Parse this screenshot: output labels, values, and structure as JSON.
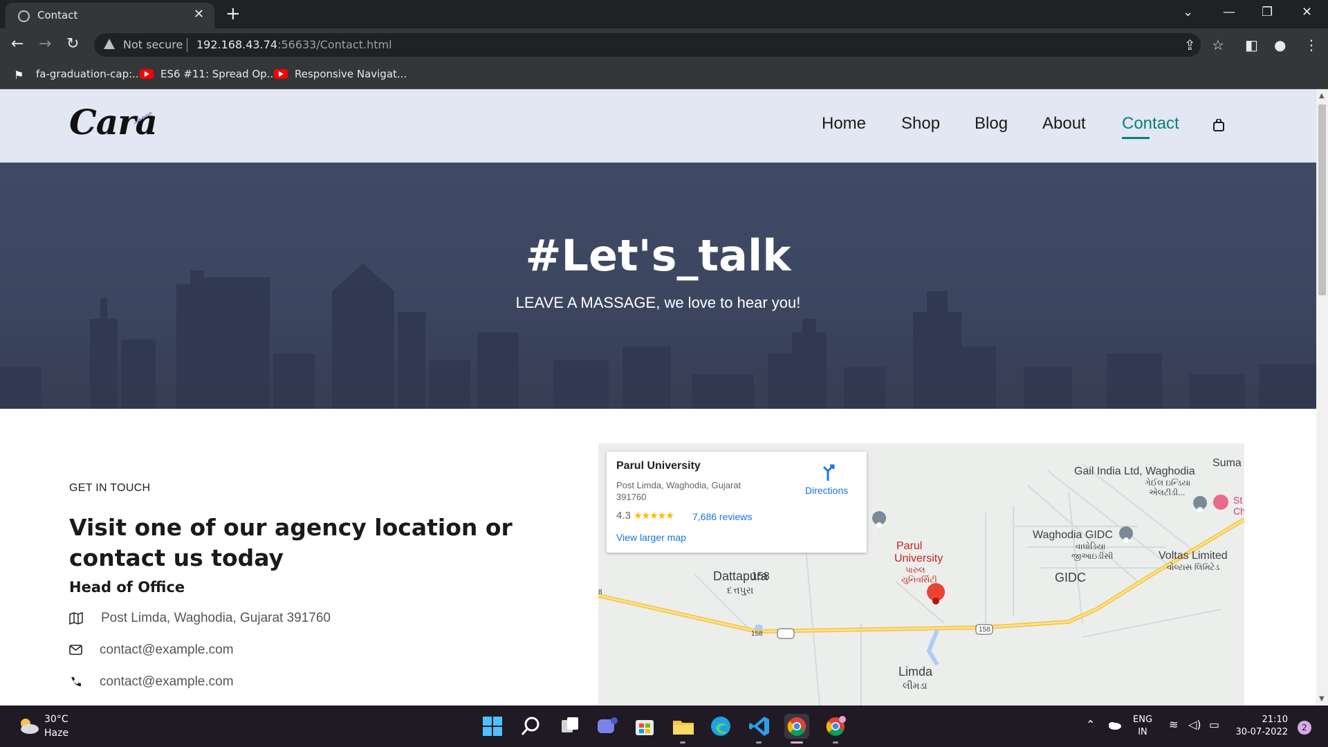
{
  "browser": {
    "tab_title": "Contact",
    "tab_close": "✕",
    "new_tab": "+",
    "window_controls": {
      "tab_search": "⌄",
      "minimize": "—",
      "restore": "❐",
      "close": "✕"
    },
    "security_label": "Not secure",
    "url_host": "192.168.43.74",
    "url_rest": ":56633/Contact.html",
    "bookmarks": [
      {
        "label": "fa-graduation-cap:...",
        "icon": "flag-icon"
      },
      {
        "label": "ES6 #11: Spread Op...",
        "icon": "youtube-icon"
      },
      {
        "label": "Responsive Navigat...",
        "icon": "youtube-icon"
      }
    ]
  },
  "site": {
    "logo": "Cara",
    "nav": [
      "Home",
      "Shop",
      "Blog",
      "About",
      "Contact"
    ],
    "active_nav": "Contact",
    "accent_color": "#088178",
    "header_bg": "#e3e6f3"
  },
  "hero": {
    "title": "#Let's_talk",
    "subtitle": "LEAVE A MASSAGE, we love to hear you!"
  },
  "contact": {
    "eyebrow": "GET IN TOUCH",
    "heading": "Visit one of our agency location or contact us today",
    "office_heading": "Head of Office",
    "rows": [
      {
        "icon": "map-icon",
        "text": "Post Limda, Waghodia, Gujarat 391760"
      },
      {
        "icon": "envelope-icon",
        "text": "contact@example.com"
      },
      {
        "icon": "phone-icon",
        "text": "contact@example.com"
      }
    ]
  },
  "map": {
    "card": {
      "title": "Parul University",
      "address": "Post Limda, Waghodia, Gujarat 391760",
      "rating": "4.3",
      "stars": "★★★★★",
      "reviews": "7,686 reviews",
      "larger_map": "View larger map",
      "directions": "Directions"
    },
    "labels": {
      "gail": "Gail India Ltd, Waghodia",
      "gail_local": "ગેઈલ ઇન્ડિયા",
      "gail_local2": "એલટીડી...",
      "suma": "Suma",
      "st": "St",
      "ch": "Ch",
      "parul": "Parul",
      "university": "University",
      "parul_local": "પારુલ",
      "parul_local2": "યુનિવર્સિટી",
      "gidc_waghodia": "Waghodia GIDC",
      "gidc_local": "વાઘોડિયા",
      "gidc_local2": "જીઆઇડીસી",
      "voltas": "Voltas Limited",
      "voltas_local": "વોલ્ટાસ લિમિટેડ",
      "gidc": "GIDC",
      "dattapura": "Dattapura",
      "dattapura_local": "દત્તપુરા",
      "limda": "Limda",
      "limda_local": "લીમડા",
      "route": "158",
      "edge_route": "8"
    }
  },
  "taskbar": {
    "temperature": "30°C",
    "weather": "Haze",
    "language": "ENG",
    "region": "IN",
    "time": "21:10",
    "date": "30-07-2022",
    "notifications": "2"
  }
}
